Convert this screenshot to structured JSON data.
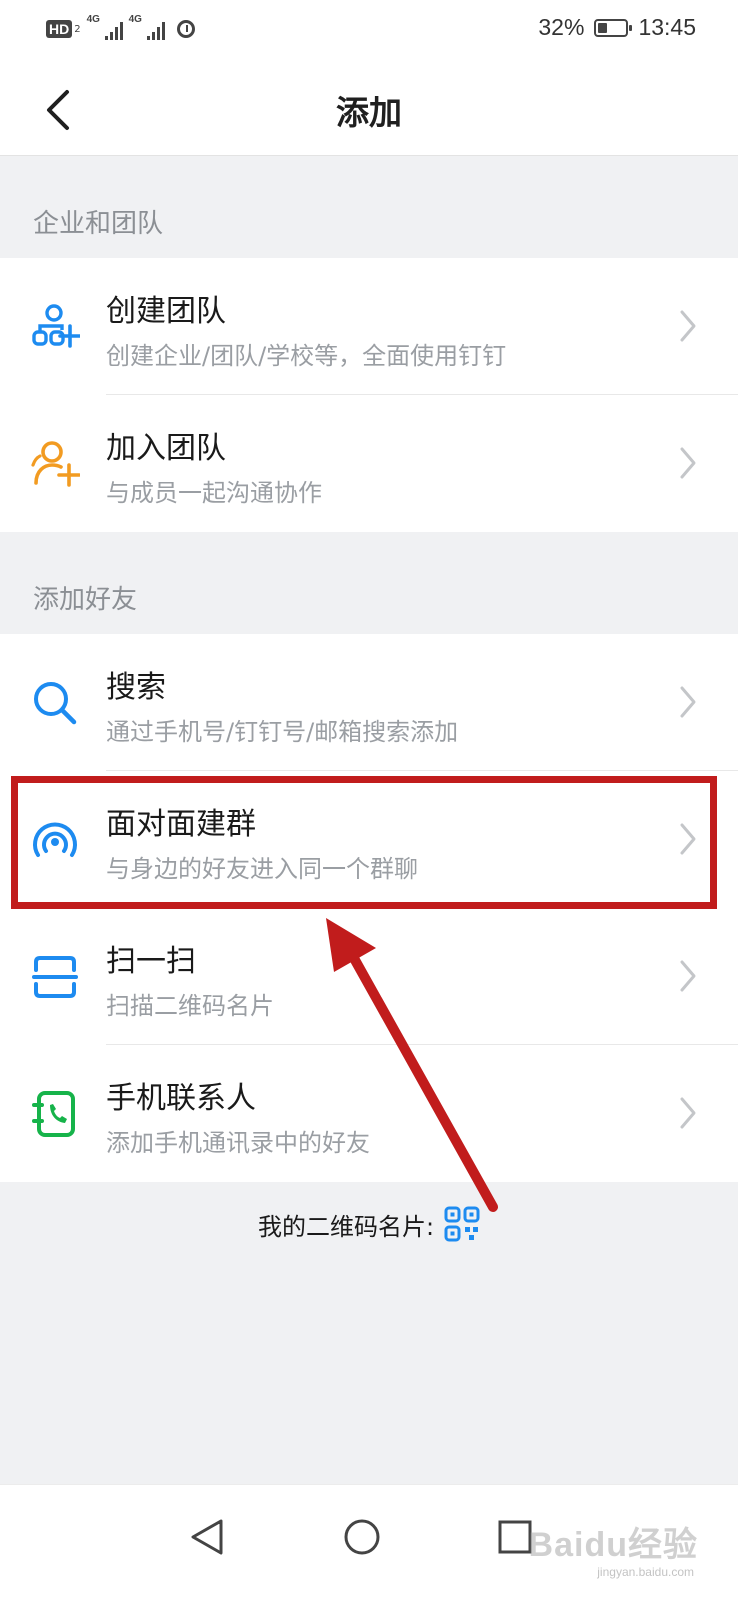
{
  "status_bar": {
    "hd_label": "HD",
    "hd_sub": "2",
    "network_1": "4G",
    "network_2": "4G",
    "battery_percent": "32%",
    "battery_level": 0.32,
    "time": "13:45"
  },
  "header": {
    "title": "添加",
    "back_icon": "chevron-left-icon"
  },
  "sections": {
    "enterprise": {
      "label": "企业和团队",
      "items": [
        {
          "title": "创建团队",
          "subtitle": "创建企业/团队/学校等，全面使用钉钉",
          "icon": "create-team-icon",
          "icon_color": "#1d8bf0"
        },
        {
          "title": "加入团队",
          "subtitle": "与成员一起沟通协作",
          "icon": "join-team-icon",
          "icon_color": "#f29b21"
        }
      ]
    },
    "friends": {
      "label": "添加好友",
      "items": [
        {
          "title": "搜索",
          "subtitle": "通过手机号/钉钉号/邮箱搜索添加",
          "icon": "search-icon",
          "icon_color": "#1d8bf0"
        },
        {
          "title": "面对面建群",
          "subtitle": "与身边的好友进入同一个群聊",
          "icon": "face-to-face-icon",
          "icon_color": "#1d8bf0"
        },
        {
          "title": "扫一扫",
          "subtitle": "扫描二维码名片",
          "icon": "scan-icon",
          "icon_color": "#1d8bf0"
        },
        {
          "title": "手机联系人",
          "subtitle": "添加手机通讯录中的好友",
          "icon": "phone-contacts-icon",
          "icon_color": "#16b34a"
        }
      ]
    }
  },
  "qr_card": {
    "label": "我的二维码名片:",
    "icon": "qr-code-icon",
    "icon_color": "#1d8bf0"
  },
  "system_nav": {
    "back": "triangle-back-icon",
    "home": "circle-home-icon",
    "recents": "square-recents-icon"
  },
  "watermark": {
    "text": "Baidu经验",
    "url": "jingyan.baidu.com"
  },
  "annotation": {
    "highlight_color": "#c11c1c",
    "target": "面对面建群"
  }
}
